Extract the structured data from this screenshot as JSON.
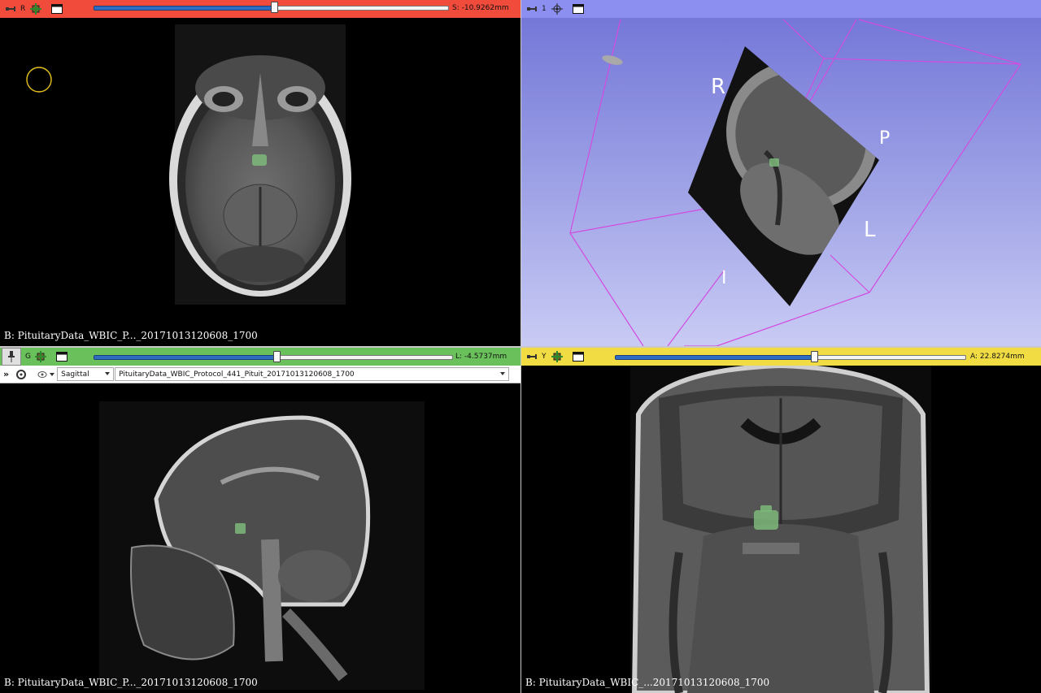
{
  "views": {
    "red": {
      "color_hex": "#f04b3b",
      "label": "R",
      "offset_text": "S: -10.9262mm",
      "slice_fraction": 0.51,
      "caption": "B: PituitaryData_WBIC_P..._20171013120608_1700"
    },
    "three_d": {
      "color_hex": "#8c8ff0",
      "label": "1",
      "orientation": {
        "r": "R",
        "p": "P",
        "l": "L",
        "i": "I"
      }
    },
    "green": {
      "color_hex": "#6ac05a",
      "label": "G",
      "offset_text": "L: -4.5737mm",
      "slice_fraction": 0.51,
      "orientation_value": "Sagittal",
      "volume_value": "PituitaryData_WBIC_Protocol_441_Pituit_20171013120608_1700",
      "expand_glyph": "»",
      "caption": "B: PituitaryData_WBIC_P..._20171013120608_1700"
    },
    "yellow": {
      "color_hex": "#f1dc43",
      "label": "Y",
      "offset_text": "A: 22.8274mm",
      "slice_fraction": 0.58,
      "caption": "B: PituitaryData_WBIC_...20171013120608_1700"
    }
  },
  "icons": [
    "pin-icon",
    "link-icon",
    "fit-to-window-icon",
    "maximize-view-icon",
    "sync-icon",
    "eye-icon"
  ]
}
